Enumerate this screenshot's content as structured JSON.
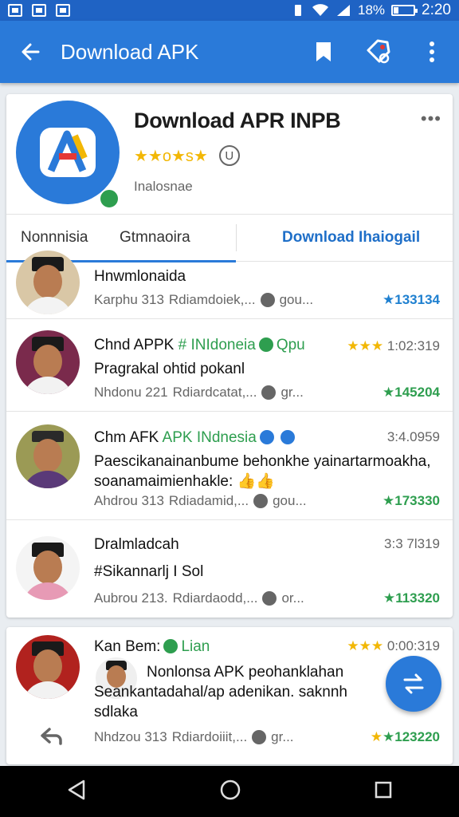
{
  "status_bar": {
    "battery": "18%",
    "time": "2:20"
  },
  "app_bar": {
    "title": "Download APK",
    "back_icon": "arrow-left-icon",
    "actions": [
      "bookmark-icon",
      "tag-icon",
      "more-vert-icon"
    ]
  },
  "app_header": {
    "title": "Download APR INPB",
    "rating_text": "★★o★s★",
    "rating_badge": "U",
    "subtitle": "Inalosnae"
  },
  "tabs": [
    {
      "label": "Nonnnisia"
    },
    {
      "label": "Gtmnaoira"
    },
    {
      "label": "Download Ihaiogail"
    }
  ],
  "posts": [
    {
      "name": "Hnwmlonaida",
      "tag": "",
      "time": "",
      "message": "",
      "meta_left": "Karphu 313",
      "meta_mid": "Rdiamdoiek,...",
      "meta_right": "gou...",
      "score": "★133134"
    },
    {
      "name": "Chnd APPK",
      "tag": "# INIdoneia",
      "extra": "Qpu",
      "time": "1:02:319",
      "message": "Pragrakal ohtid pokanl",
      "meta_left": "Nhdonu 221",
      "meta_mid": "Rdiardcatat,...",
      "meta_right": "gr...",
      "score": "★145204"
    },
    {
      "name": "Chm AFK",
      "tag": "APK INdnesia",
      "time": "3:4.0959",
      "message": "Paescikanainanbume behonkhe yainartarmoakha, soanamaimienhakle: 👍👍",
      "meta_left": "Ahdrou 313",
      "meta_mid": "Rdiadamid,...",
      "meta_right": "gou...",
      "score": "★173330"
    },
    {
      "name": "Dralmladcah",
      "tag": "",
      "time": "3:3 7l319",
      "message": "#Sikannarlj I Sol",
      "meta_left": "Aubrou 213.",
      "meta_mid": "Rdiardaodd,...",
      "meta_right": "or...",
      "score": "★113320"
    },
    {
      "name": "Kan Bem:",
      "tag": "Lian",
      "time": "0:00:319",
      "message": "Nonlonsa APK peohanklahan Seankantadahal/ap adenikan. saknnh sdlaka",
      "meta_left": "Nhdzou 313",
      "meta_mid": "Rdiardoiiit,...",
      "meta_right": "gr...",
      "score": "★123220"
    }
  ],
  "colors": {
    "primary": "#2a7ad9",
    "status": "#1f63c4",
    "green": "#2e9e4f",
    "star": "#f2b705"
  }
}
